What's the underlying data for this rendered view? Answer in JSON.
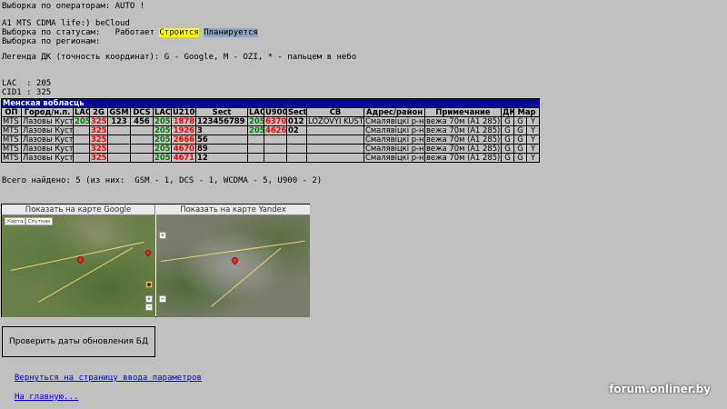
{
  "header": {
    "operators": "Выборка по операторам: AUTO !",
    "network": "A1 MTS CDMA life:) beCloud",
    "status_label": "Выборка по статусам:   ",
    "status_works": "Работает ",
    "status_building": "Строится",
    "status_planned": "Планируется",
    "regions": "Выборка по регионам:",
    "legend": "Легенда ДК (точность координат): G - Google, M - OZI, * - пальцем в небо",
    "lac": "LAC  : 205",
    "cid": "CID1 : 325"
  },
  "table": {
    "region": "Менская вобласць",
    "columns": [
      "ОП",
      "Город/н.п.",
      "LAC",
      "2G",
      "GSM",
      "DCS",
      "LAC",
      "U2100",
      "Sect",
      "LAC",
      "U900",
      "Sect",
      "CB",
      "Адрес/район",
      "Примечание",
      "ДК",
      "Мар"
    ],
    "rows": [
      {
        "op": "MTS",
        "city": "Лазовы Куст",
        "lac2g": "205",
        "cid2g": "325",
        "gsm": "123",
        "dcs": "456",
        "lac3g": "205",
        "u2100": "1878",
        "sect": "123456789",
        "lac900": "205",
        "u900": "6370",
        "sect900": "012",
        "cb": "LOZOVYI KUST",
        "addr": "Смалявіцкі р-н",
        "note": "вежа 70м (A1 285)",
        "dk": "G",
        "mar1": "G",
        "mar2": "Y"
      },
      {
        "op": "MTS",
        "city": "Лазовы Куст",
        "lac2g": "",
        "cid2g": "325",
        "gsm": "",
        "dcs": "",
        "lac3g": "205",
        "u2100": "1926",
        "sect": "3",
        "lac900": "205",
        "u900": "4626",
        "sect900": "02",
        "cb": "",
        "addr": "Смалявіцкі р-н",
        "note": "вежа 70м (A1 285)",
        "dk": "G",
        "mar1": "G",
        "mar2": "Y"
      },
      {
        "op": "MTS",
        "city": "Лазовы Куст",
        "lac2g": "",
        "cid2g": "325",
        "gsm": "",
        "dcs": "",
        "lac3g": "205",
        "u2100": "2666",
        "sect": "56",
        "lac900": "",
        "u900": "",
        "sect900": "",
        "cb": "",
        "addr": "Смалявіцкі р-н",
        "note": "вежа 70м (A1 285)",
        "dk": "G",
        "mar1": "G",
        "mar2": "Y"
      },
      {
        "op": "MTS",
        "city": "Лазовы Куст",
        "lac2g": "",
        "cid2g": "325",
        "gsm": "",
        "dcs": "",
        "lac3g": "205",
        "u2100": "4670",
        "sect": "89",
        "lac900": "",
        "u900": "",
        "sect900": "",
        "cb": "",
        "addr": "Смалявіцкі р-н",
        "note": "вежа 70м (A1 285)",
        "dk": "G",
        "mar1": "G",
        "mar2": "Y"
      },
      {
        "op": "MTS",
        "city": "Лазовы Куст",
        "lac2g": "",
        "cid2g": "325",
        "gsm": "",
        "dcs": "",
        "lac3g": "205",
        "u2100": "4671",
        "sect": "12",
        "lac900": "",
        "u900": "",
        "sect900": "",
        "cb": "",
        "addr": "Смалявіцкі р-н",
        "note": "вежа 70м (A1 285)",
        "dk": "G",
        "mar1": "G",
        "mar2": "Y"
      }
    ]
  },
  "summary": "Всего найдено: 5 (из них:  GSM - 1, DCS - 1, WCDMA - 5, U900 - 2)",
  "maps": {
    "google_tab": "Показать на карте Google",
    "yandex_tab": "Показать на карте Yandex",
    "google_map_btn": "Карта",
    "google_sat_btn": "Спутник"
  },
  "check_button": "Проверить даты обновления БД",
  "links": {
    "back": "Вернуться на страницу ввода параметров",
    "home": "На главную..."
  },
  "watermark": "forum.onliner.by",
  "colors": {
    "background": "#c0c0c0",
    "region_bar": "#0000a8",
    "green_value": "#008000",
    "red_value": "#ff0000",
    "status_building": "#ffff00",
    "status_planned": "#8fa4c0",
    "link": "#0000ee"
  }
}
